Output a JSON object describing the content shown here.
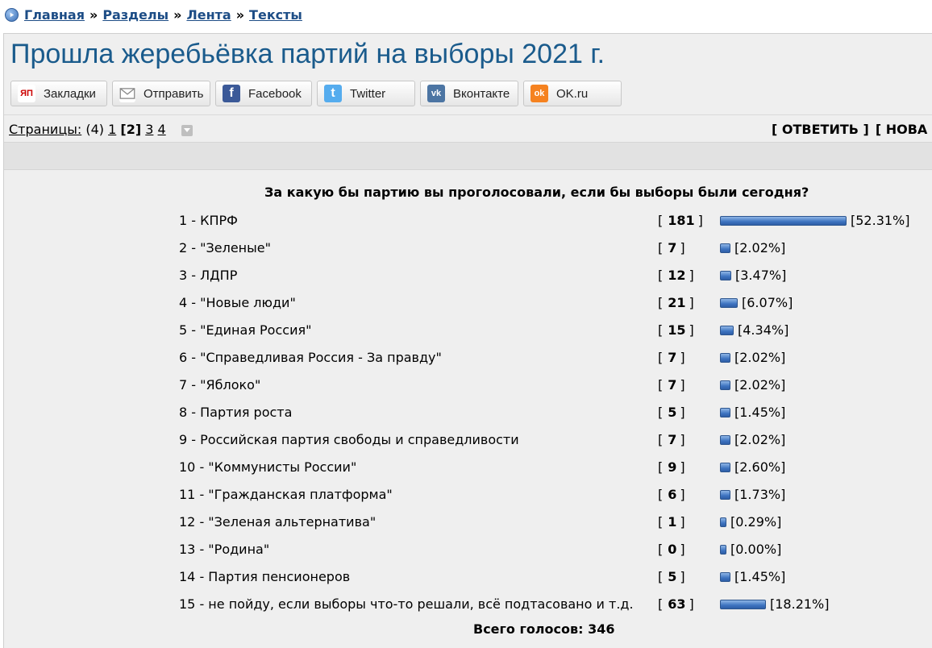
{
  "breadcrumb": [
    "Главная",
    "Разделы",
    "Лента",
    "Тексты"
  ],
  "breadcrumb_sep": "»",
  "title": "Прошла жеребьёвка партий на выборы 2021 г.",
  "share": [
    {
      "label": "Закладки",
      "icon": "yandex-bookmarks-icon",
      "icon_text": "ЯП",
      "color": "#ffffff",
      "text_color": "#cc0000"
    },
    {
      "label": "Отправить",
      "icon": "envelope-icon",
      "icon_text": "",
      "color": "#ffffff",
      "text_color": "#888888"
    },
    {
      "label": "Facebook",
      "icon": "facebook-icon",
      "icon_text": "f",
      "color": "#3b5998",
      "text_color": "#ffffff"
    },
    {
      "label": "Twitter",
      "icon": "twitter-icon",
      "icon_text": "t",
      "color": "#55acee",
      "text_color": "#ffffff"
    },
    {
      "label": "Вконтакте",
      "icon": "vk-icon",
      "icon_text": "vk",
      "color": "#4c75a3",
      "text_color": "#ffffff"
    },
    {
      "label": "OK.ru",
      "icon": "odnoklassniki-icon",
      "icon_text": "ok",
      "color": "#f58220",
      "text_color": "#ffffff"
    }
  ],
  "pager": {
    "label": "Страницы:",
    "count": "(4)",
    "pages": [
      "1",
      "[2]",
      "3",
      "4"
    ],
    "current": "[2]"
  },
  "actions": [
    "[ ОТВЕТИТЬ ]",
    "[ НОВА"
  ],
  "poll": {
    "question": "За какую бы партию вы проголосовали, если бы выборы были сегодня?",
    "options": [
      {
        "label": "1 - КПРФ",
        "votes": "181",
        "percent": "[52.31%]",
        "share": 52.31
      },
      {
        "label": "2 - \"Зеленые\"",
        "votes": "7",
        "percent": "[2.02%]",
        "share": 2.02
      },
      {
        "label": "3 - ЛДПР",
        "votes": "12",
        "percent": "[3.47%]",
        "share": 3.47
      },
      {
        "label": "4 - \"Новые люди\"",
        "votes": "21",
        "percent": "[6.07%]",
        "share": 6.07
      },
      {
        "label": "5 - \"Единая Россия\"",
        "votes": "15",
        "percent": "[4.34%]",
        "share": 4.34
      },
      {
        "label": "6 - \"Справедливая Россия - За правду\"",
        "votes": "7",
        "percent": "[2.02%]",
        "share": 2.02
      },
      {
        "label": "7 - \"Яблоко\"",
        "votes": "7",
        "percent": "[2.02%]",
        "share": 2.02
      },
      {
        "label": "8 - Партия роста",
        "votes": "5",
        "percent": "[1.45%]",
        "share": 1.45
      },
      {
        "label": "9 - Российская партия свободы и справедливости",
        "votes": "7",
        "percent": "[2.02%]",
        "share": 2.02
      },
      {
        "label": "10 - \"Коммунисты России\"",
        "votes": "9",
        "percent": "[2.60%]",
        "share": 2.6
      },
      {
        "label": "11 - \"Гражданская платформа\"",
        "votes": "6",
        "percent": "[1.73%]",
        "share": 1.73
      },
      {
        "label": "12 - \"Зеленая альтернатива\"",
        "votes": "1",
        "percent": "[0.29%]",
        "share": 0.29
      },
      {
        "label": "13 - \"Родина\"",
        "votes": "0",
        "percent": "[0.00%]",
        "share": 0.0
      },
      {
        "label": "14 - Партия пенсионеров",
        "votes": "5",
        "percent": "[1.45%]",
        "share": 1.45
      },
      {
        "label": "15 - не пойду, если выборы что-то решали, всё подтасовано и т.д.",
        "votes": "63",
        "percent": "[18.21%]",
        "share": 18.21
      }
    ],
    "total": "Всего голосов: 346"
  }
}
